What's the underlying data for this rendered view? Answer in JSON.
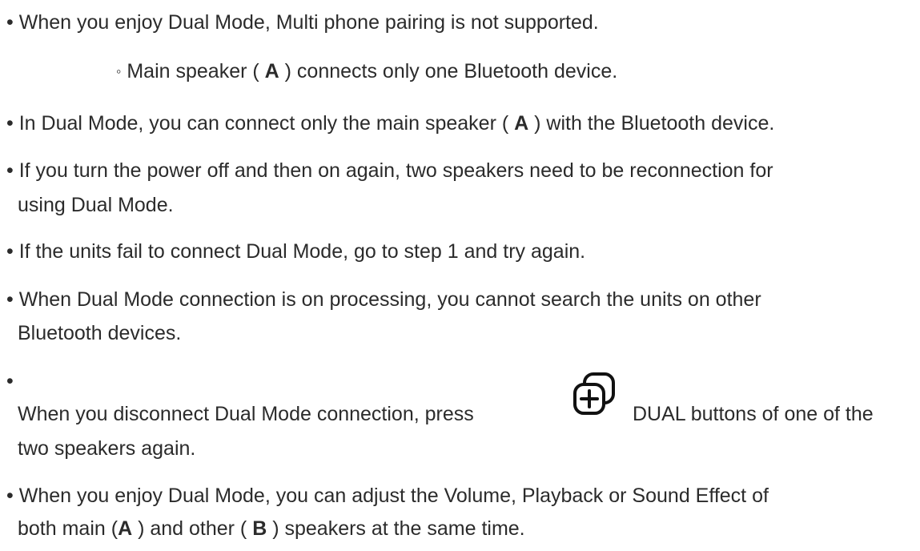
{
  "notes": {
    "bullet_symbol": "•",
    "sub_bullet_symbol": "◦",
    "item1": "When you enjoy Dual Mode, Multi phone pairing is not supported.",
    "item1_sub_pre": "Main speaker ( ",
    "item1_sub_bold": "A",
    "item1_sub_post": " ) connects only one Bluetooth device.",
    "item2_pre": "In Dual Mode, you can connect only the main speaker ( ",
    "item2_bold": "A",
    "item2_post": " ) with the Bluetooth device.",
    "item3_line1": "If you turn the power off and then on again, two speakers need to be reconnection for",
    "item3_line2": "using Dual Mode.",
    "item4": "If the units fail to connect Dual Mode, go to step 1 and try again.",
    "item5_line1": "When Dual Mode connection is on processing, you cannot search the units on other",
    "item5_line2": "Bluetooth devices.",
    "item6_pre": "When you disconnect Dual Mode connection, press",
    "item6_icon": "dual-button-icon",
    "item6_post": "DUAL buttons of one of the",
    "item6_line2": "two speakers again.",
    "item7_line1": "When you enjoy Dual Mode, you can adjust the Volume, Playback or Sound Effect of",
    "item7_line2_pre": "both main (",
    "item7_line2_bold1": "A",
    "item7_line2_mid": " ) and other ( ",
    "item7_line2_bold2": "B",
    "item7_line2_post": " ) speakers at the same time."
  }
}
